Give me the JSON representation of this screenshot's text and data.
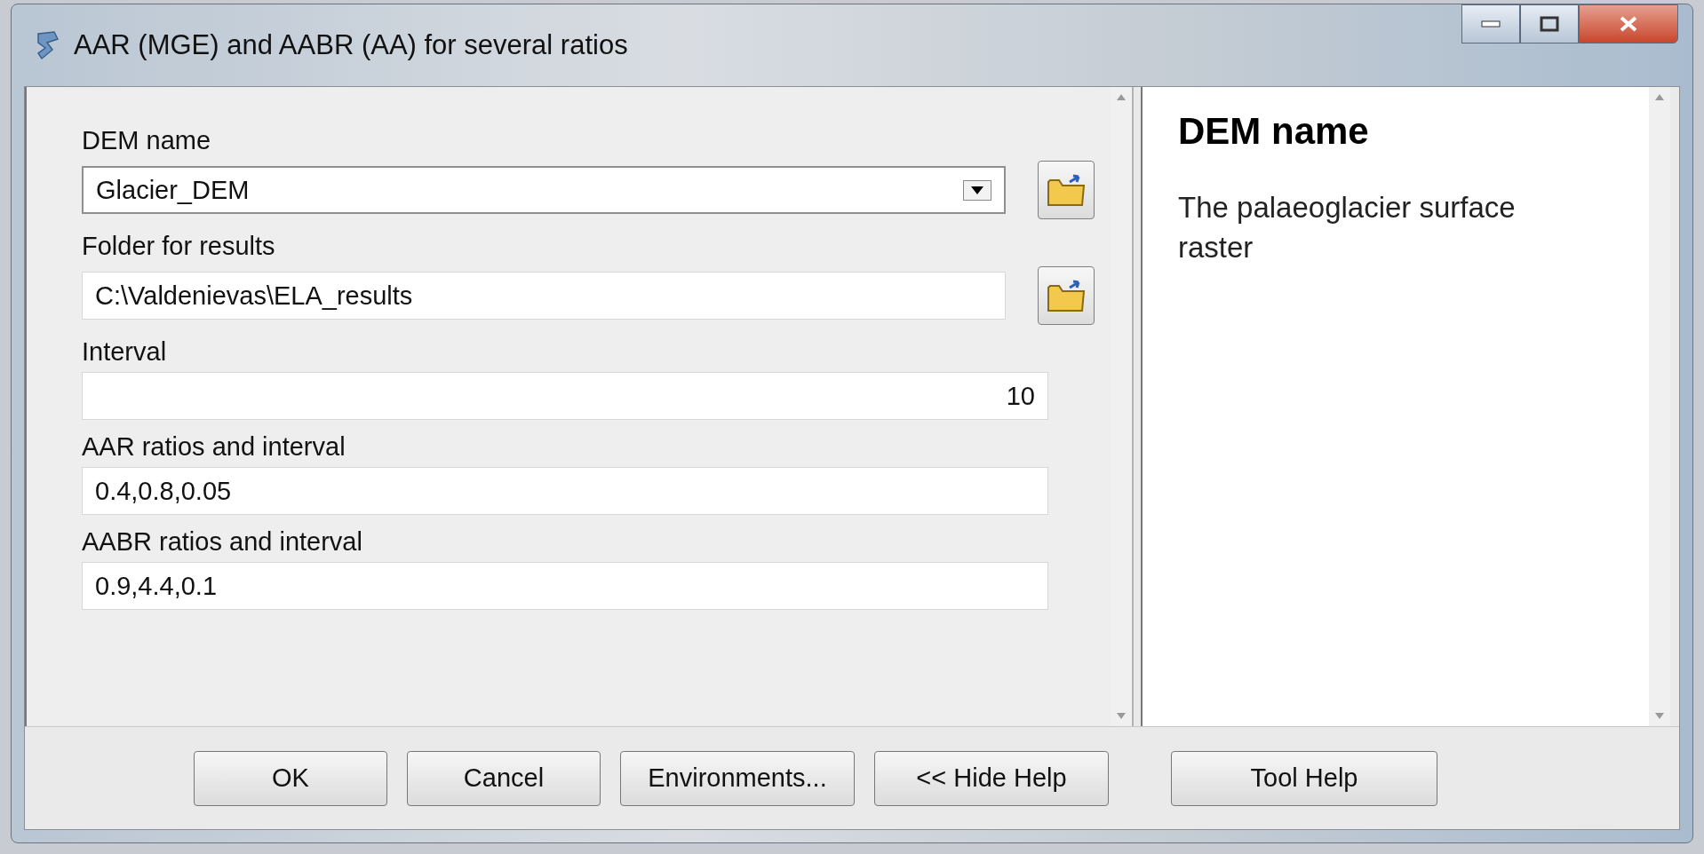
{
  "window": {
    "title": "AAR (MGE) and AABR (AA) for several ratios"
  },
  "params": [
    {
      "label": "DEM name",
      "kind": "dropdown",
      "value": "Glacier_DEM"
    },
    {
      "label": "Folder for results",
      "kind": "folder",
      "value": "C:\\Valdenievas\\ELA_results"
    },
    {
      "label": "Interval",
      "kind": "number",
      "value": "10"
    },
    {
      "label": "AAR ratios and interval",
      "kind": "text",
      "value": "0.4,0.8,0.05"
    },
    {
      "label": "AABR ratios and interval",
      "kind": "text",
      "value": "0.9,4.4,0.1"
    }
  ],
  "help": {
    "title": "DEM name",
    "text": "The palaeoglacier surface raster"
  },
  "buttons": [
    "OK",
    "Cancel",
    "Environments...",
    "<< Hide Help"
  ],
  "help_buttons": [
    "Tool Help"
  ]
}
